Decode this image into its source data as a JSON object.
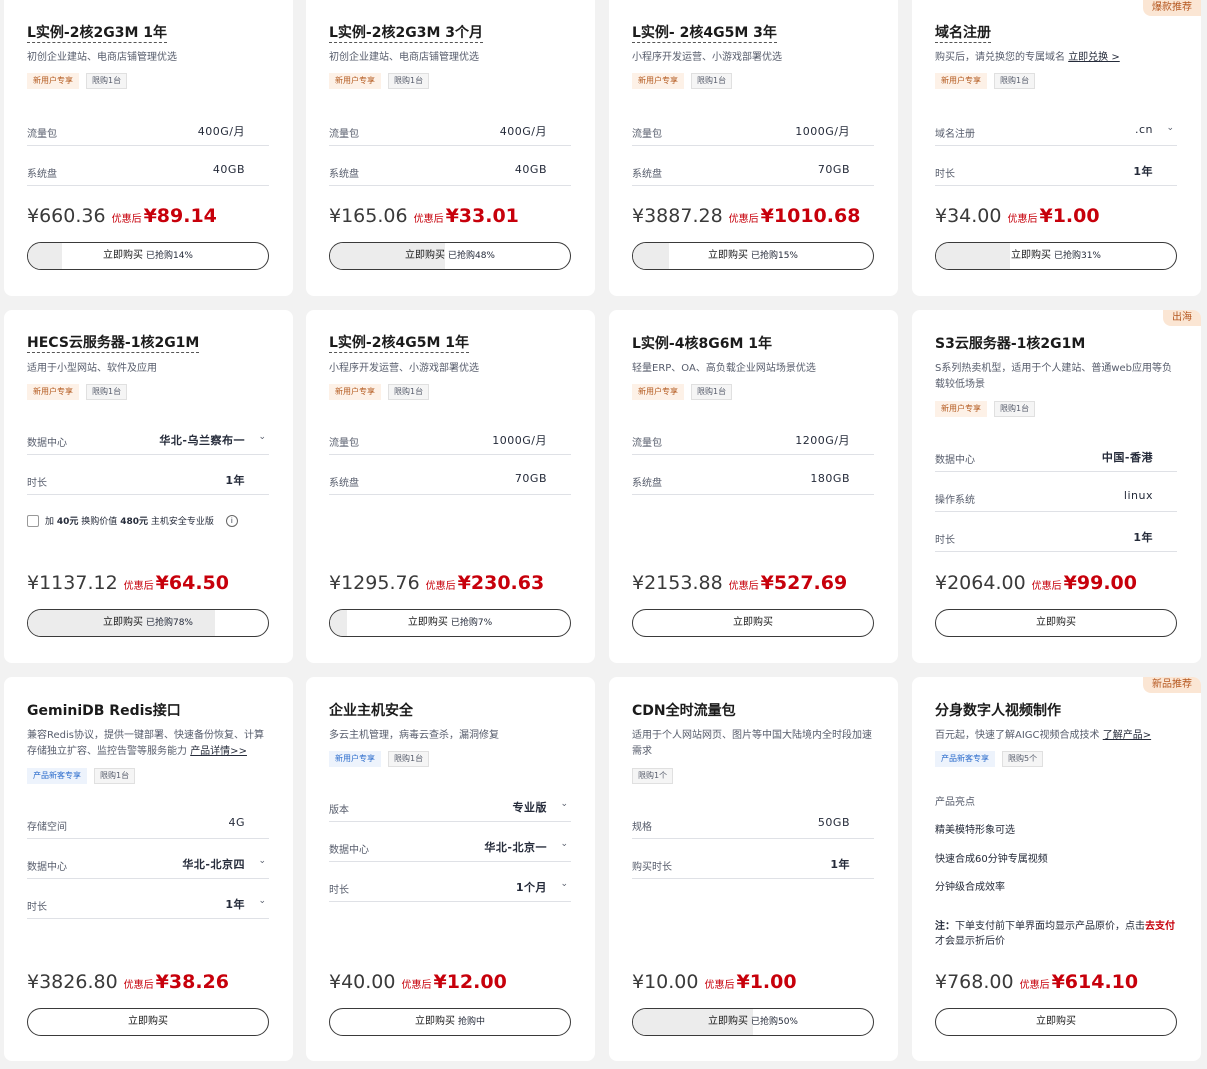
{
  "cards": [
    {
      "title": "L实例-2核2G3M 1年",
      "desc": "初创企业建站、电商店铺管理优选",
      "tags": [
        "新用户专享",
        "限购1台"
      ],
      "rows": [
        {
          "label": "流量包",
          "value": "400G/月"
        },
        {
          "label": "系统盘",
          "value": "40GB"
        }
      ],
      "orig": "¥660.36",
      "disc_label": "优惠后",
      "price": "¥89.14",
      "buy": "立即购买",
      "progress_text": "已抢购14%",
      "progress": 14
    },
    {
      "title": "L实例-2核2G3M 3个月",
      "desc": "初创企业建站、电商店铺管理优选",
      "tags": [
        "新用户专享",
        "限购1台"
      ],
      "rows": [
        {
          "label": "流量包",
          "value": "400G/月"
        },
        {
          "label": "系统盘",
          "value": "40GB"
        }
      ],
      "orig": "¥165.06",
      "disc_label": "优惠后",
      "price": "¥33.01",
      "buy": "立即购买",
      "progress_text": "已抢购48%",
      "progress": 48
    },
    {
      "title": "L实例- 2核4G5M 3年",
      "desc": "小程序开发运营、小游戏部署优选",
      "tags": [
        "新用户专享",
        "限购1台"
      ],
      "rows": [
        {
          "label": "流量包",
          "value": "1000G/月"
        },
        {
          "label": "系统盘",
          "value": "70GB"
        }
      ],
      "orig": "¥3887.28",
      "disc_label": "优惠后",
      "price": "¥1010.68",
      "buy": "立即购买",
      "progress_text": "已抢购15%",
      "progress": 15
    },
    {
      "corner": "爆款推荐",
      "title": "域名注册",
      "desc": "购买后，请兑换您的专属域名",
      "desc_link": "立即兑换 >",
      "tags": [
        "新用户专享",
        "限购1台"
      ],
      "rows": [
        {
          "label": "域名注册",
          "value": ".cn"
        },
        {
          "label": "时长",
          "value": "1年"
        }
      ],
      "orig": "¥34.00",
      "disc_label": "优惠后",
      "price": "¥1.00",
      "buy": "立即购买",
      "progress_text": "已抢购31%",
      "progress": 31
    },
    {
      "title": "HECS云服务器-1核2G1M",
      "desc": "适用于小型网站、软件及应用",
      "tags": [
        "新用户专享",
        "限购1台"
      ],
      "rows": [
        {
          "label": "数据中心",
          "value": "华北-乌兰察布一"
        },
        {
          "label": "时长",
          "value": "1年"
        }
      ],
      "checkbox": {
        "pre": "加",
        "amt1": "40元",
        "mid": "换购价值",
        "amt2": "480元",
        "post": "主机安全专业版"
      },
      "orig": "¥1137.12",
      "disc_label": "优惠后",
      "price": "¥64.50",
      "buy": "立即购买",
      "progress_text": "已抢购78%",
      "progress": 78
    },
    {
      "title": "L实例-2核4G5M 1年",
      "desc": "小程序开发运营、小游戏部署优选",
      "tags": [
        "新用户专享",
        "限购1台"
      ],
      "rows": [
        {
          "label": "流量包",
          "value": "1000G/月"
        },
        {
          "label": "系统盘",
          "value": "70GB"
        }
      ],
      "orig": "¥1295.76",
      "disc_label": "优惠后",
      "price": "¥230.63",
      "buy": "立即购买",
      "progress_text": "已抢购7%",
      "progress": 7
    },
    {
      "title": "L实例-4核8G6M 1年",
      "desc": "轻量ERP、OA、高负载企业网站场景优选",
      "tags": [
        "新用户专享",
        "限购1台"
      ],
      "rows": [
        {
          "label": "流量包",
          "value": "1200G/月"
        },
        {
          "label": "系统盘",
          "value": "180GB"
        }
      ],
      "orig": "¥2153.88",
      "disc_label": "优惠后",
      "price": "¥527.69",
      "buy": "立即购买"
    },
    {
      "corner": "出海",
      "title": "S3云服务器-1核2G1M",
      "desc": "S系列热卖机型，适用于个人建站、普通web应用等负载较低场景",
      "tags": [
        "新用户专享",
        "限购1台"
      ],
      "rows": [
        {
          "label": "数据中心",
          "value": "中国-香港"
        },
        {
          "label": "操作系统",
          "value": "linux"
        },
        {
          "label": "时长",
          "value": "1年"
        }
      ],
      "orig": "¥2064.00",
      "disc_label": "优惠后",
      "price": "¥99.00",
      "buy": "立即购买"
    },
    {
      "title": "GeminiDB Redis接口",
      "desc": "兼容Redis协议，提供一键部署、快速备份恢复、计算存储独立扩容、监控告警等服务能力",
      "desc_link": "产品详情>>",
      "tags": [
        "产品新客专享",
        "限购1台"
      ],
      "rows": [
        {
          "label": "存储空间",
          "value": "4G"
        },
        {
          "label": "数据中心",
          "value": "华北-北京四"
        },
        {
          "label": "时长",
          "value": "1年"
        }
      ],
      "orig": "¥3826.80",
      "disc_label": "优惠后",
      "price": "¥38.26",
      "buy": "立即购买"
    },
    {
      "title": "企业主机安全",
      "desc": "多云主机管理，病毒云查杀，漏洞修复",
      "tags": [
        "新用户专享",
        "限购1台"
      ],
      "rows": [
        {
          "label": "版本",
          "value": "专业版"
        },
        {
          "label": "数据中心",
          "value": "华北-北京一"
        },
        {
          "label": "时长",
          "value": "1个月"
        }
      ],
      "orig": "¥40.00",
      "disc_label": "优惠后",
      "price": "¥12.00",
      "buy": "立即购买",
      "progress_text": "抢购中"
    },
    {
      "title": "CDN全时流量包",
      "desc": "适用于个人网站网页、图片等中国大陆境内全时段加速需求",
      "tags": [
        "限购1个"
      ],
      "rows": [
        {
          "label": "规格",
          "value": "50GB"
        },
        {
          "label": "购买时长",
          "value": "1年"
        }
      ],
      "orig": "¥10.00",
      "disc_label": "优惠后",
      "price": "¥1.00",
      "buy": "立即购买",
      "progress_text": "已抢购50%",
      "progress": 50
    },
    {
      "corner": "新品推荐",
      "title": "分身数字人视频制作",
      "desc": "百元起，快速了解AIGC视频合成技术",
      "desc_link": "了解产品>",
      "tags": [
        "产品新客专享",
        "限购5个"
      ],
      "section": "产品亮点",
      "features": [
        "精美模特形象可选",
        "快速合成60分钟专属视频",
        "分钟级合成效率"
      ],
      "note": {
        "lead": "注：",
        "text": "下单支付前下单界面均显示产品原价，点击",
        "link": "去支付",
        "tail": "才会显示折后价"
      },
      "orig": "¥768.00",
      "disc_label": "优惠后",
      "price": "¥614.10",
      "buy": "立即购买"
    }
  ]
}
